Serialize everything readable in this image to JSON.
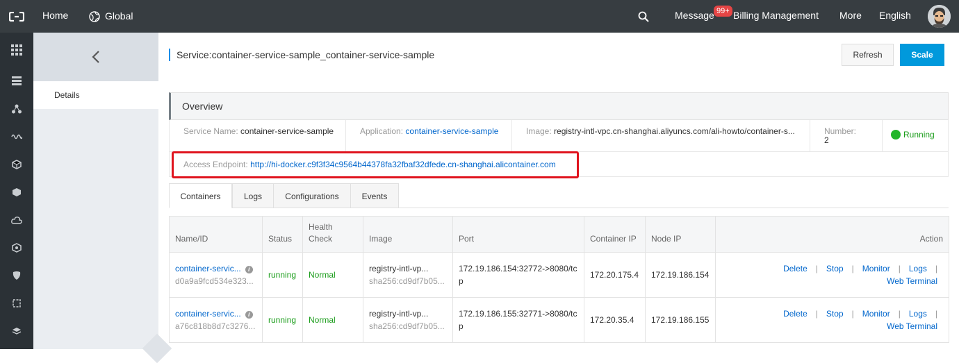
{
  "topbar": {
    "home": "Home",
    "region": "Global",
    "message": "Message",
    "message_badge": "99+",
    "billing": "Billing Management",
    "more": "More",
    "language": "English"
  },
  "sidebar": {
    "details": "Details"
  },
  "page": {
    "title": "Service:container-service-sample_container-service-sample",
    "refresh_label": "Refresh",
    "scale_label": "Scale"
  },
  "overview": {
    "heading": "Overview",
    "service_name_label": "Service Name:",
    "service_name_value": "container-service-sample",
    "application_label": "Application:",
    "application_value": "container-service-sample",
    "image_label": "Image:",
    "image_value": "registry-intl-vpc.cn-shanghai.aliyuncs.com/ali-howto/container-s...",
    "number_label": "Number:",
    "number_value": "2",
    "status": "Running",
    "endpoint_label": "Access Endpoint:",
    "endpoint_value": "http://hi-docker.c9f3f34c9564b44378fa32fbaf32dfede.cn-shanghai.alicontainer.com"
  },
  "tabs": [
    "Containers",
    "Logs",
    "Configurations",
    "Events"
  ],
  "table": {
    "headers": {
      "name": "Name/ID",
      "status": "Status",
      "health": "Health Check",
      "image": "Image",
      "port": "Port",
      "container_ip": "Container IP",
      "node_ip": "Node IP",
      "action": "Action"
    },
    "rows": [
      {
        "name": "container-servic...",
        "id": "d0a9a9fcd534e323...",
        "status": "running",
        "health": "Normal",
        "image": "registry-intl-vp...",
        "digest": "sha256:cd9df7b05...",
        "port": "172.19.186.154:32772->8080/tcp",
        "container_ip": "172.20.175.4",
        "node_ip": "172.19.186.154"
      },
      {
        "name": "container-servic...",
        "id": "a76c818b8d7c3276...",
        "status": "running",
        "health": "Normal",
        "image": "registry-intl-vp...",
        "digest": "sha256:cd9df7b05...",
        "port": "172.19.186.155:32771->8080/tcp",
        "container_ip": "172.20.35.4",
        "node_ip": "172.19.186.155"
      }
    ],
    "actions": {
      "delete": "Delete",
      "stop": "Stop",
      "monitor": "Monitor",
      "logs": "Logs",
      "web_terminal": "Web Terminal"
    }
  }
}
